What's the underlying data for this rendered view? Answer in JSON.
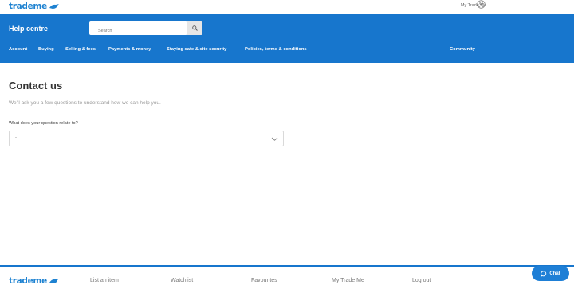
{
  "header": {
    "logo_part1": "trade",
    "logo_part2": "me",
    "my_trade_me": "My Trade Me"
  },
  "hero": {
    "title": "Help centre",
    "search_placeholder": "Search"
  },
  "nav": {
    "items": [
      "Account",
      "Buying",
      "Selling & fees",
      "Payments & money",
      "Staying safe & site security",
      "Policies, terms & conditions",
      "Community"
    ]
  },
  "main": {
    "title": "Contact us",
    "subtitle": "We'll ask you a few questions to understand how we can help you.",
    "question_label": "What does your question relate to?",
    "select_value": "-"
  },
  "footer": {
    "logo_part1": "trade",
    "logo_part2": "me",
    "links": [
      "List an item",
      "Watchlist",
      "Favourites",
      "My Trade Me",
      "Log out"
    ]
  },
  "chat": {
    "label": "Chat"
  },
  "colors": {
    "brand_blue": "#1776cd",
    "white": "#ffffff"
  }
}
